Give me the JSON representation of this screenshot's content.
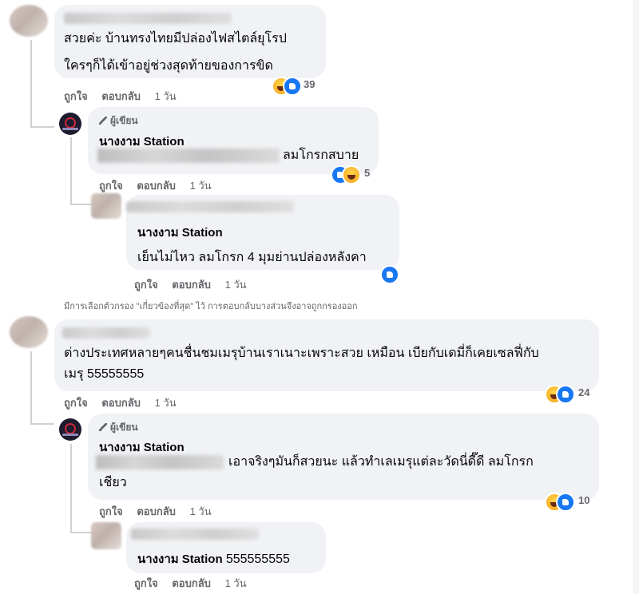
{
  "comments": [
    {
      "text_lines": [
        "สวยค่ะ บ้านทรงไทยมีปล่องไฟสไตล์ยุโรป",
        "ใครๆก็ได้เข้าอยู่ช่วงสุดท้ายของการขิด"
      ],
      "actions": {
        "like": "ถูกใจ",
        "reply": "ตอบกลับ",
        "time": "1 วัน"
      },
      "reaction_count": "39",
      "replies": [
        {
          "author_tag": "ผู้เขียน",
          "author": "นางงาม Station",
          "text_visible": "ลมโกรกสบาย",
          "actions": {
            "like": "ถูกใจ",
            "reply": "ตอบกลับ",
            "time": "1 วัน"
          },
          "reaction_count": "5"
        },
        {
          "author": "นางงาม Station",
          "text": "เย็นไม่ไหว ลมโกรก 4 มุมย่านปล่องหลังคา",
          "actions": {
            "like": "ถูกใจ",
            "reply": "ตอบกลับ",
            "time": "1 วัน"
          }
        }
      ]
    },
    {
      "text_lines": [
        "ต่างประเทศหลายๆคนชื่นชมเมรุบ้านเราเนาะเพราะสวย เหมือน เบียกับเดมี่ก็เคยเซลฟี่กับ",
        "เมรุ 55555555"
      ],
      "actions": {
        "like": "ถูกใจ",
        "reply": "ตอบกลับ",
        "time": "1 วัน"
      },
      "reaction_count": "24",
      "replies": [
        {
          "author_tag": "ผู้เขียน",
          "author": "นางงาม Station",
          "text_visible": "เอาจริงๆมันก็สวยนะ แล้วทำเลเมรุแต่ละวัดนี่ดี๊ดี ลมโกรก",
          "text_line2": "เชียว",
          "actions": {
            "like": "ถูกใจ",
            "reply": "ตอบกลับ",
            "time": "1 วัน"
          },
          "reaction_count": "10"
        },
        {
          "author": "นางงาม Station",
          "text_after": "555555555",
          "actions": {
            "like": "ถูกใจ",
            "reply": "ตอบกลับ",
            "time": "1 วัน"
          }
        }
      ]
    }
  ],
  "filter_note": "มีการเลือกตัวกรอง \"เกี่ยวข้องที่สุด\" ไว้ การตอบกลับบางส่วนจึงอาจถูกกรองออก",
  "colors": {
    "bubble": "#f0f2f5",
    "secondary_text": "#65676b",
    "like_blue": "#1877f2",
    "thread_line": "#ced0d4"
  },
  "icons": [
    "haha-reaction-icon",
    "like-reaction-icon",
    "pencil-icon"
  ]
}
